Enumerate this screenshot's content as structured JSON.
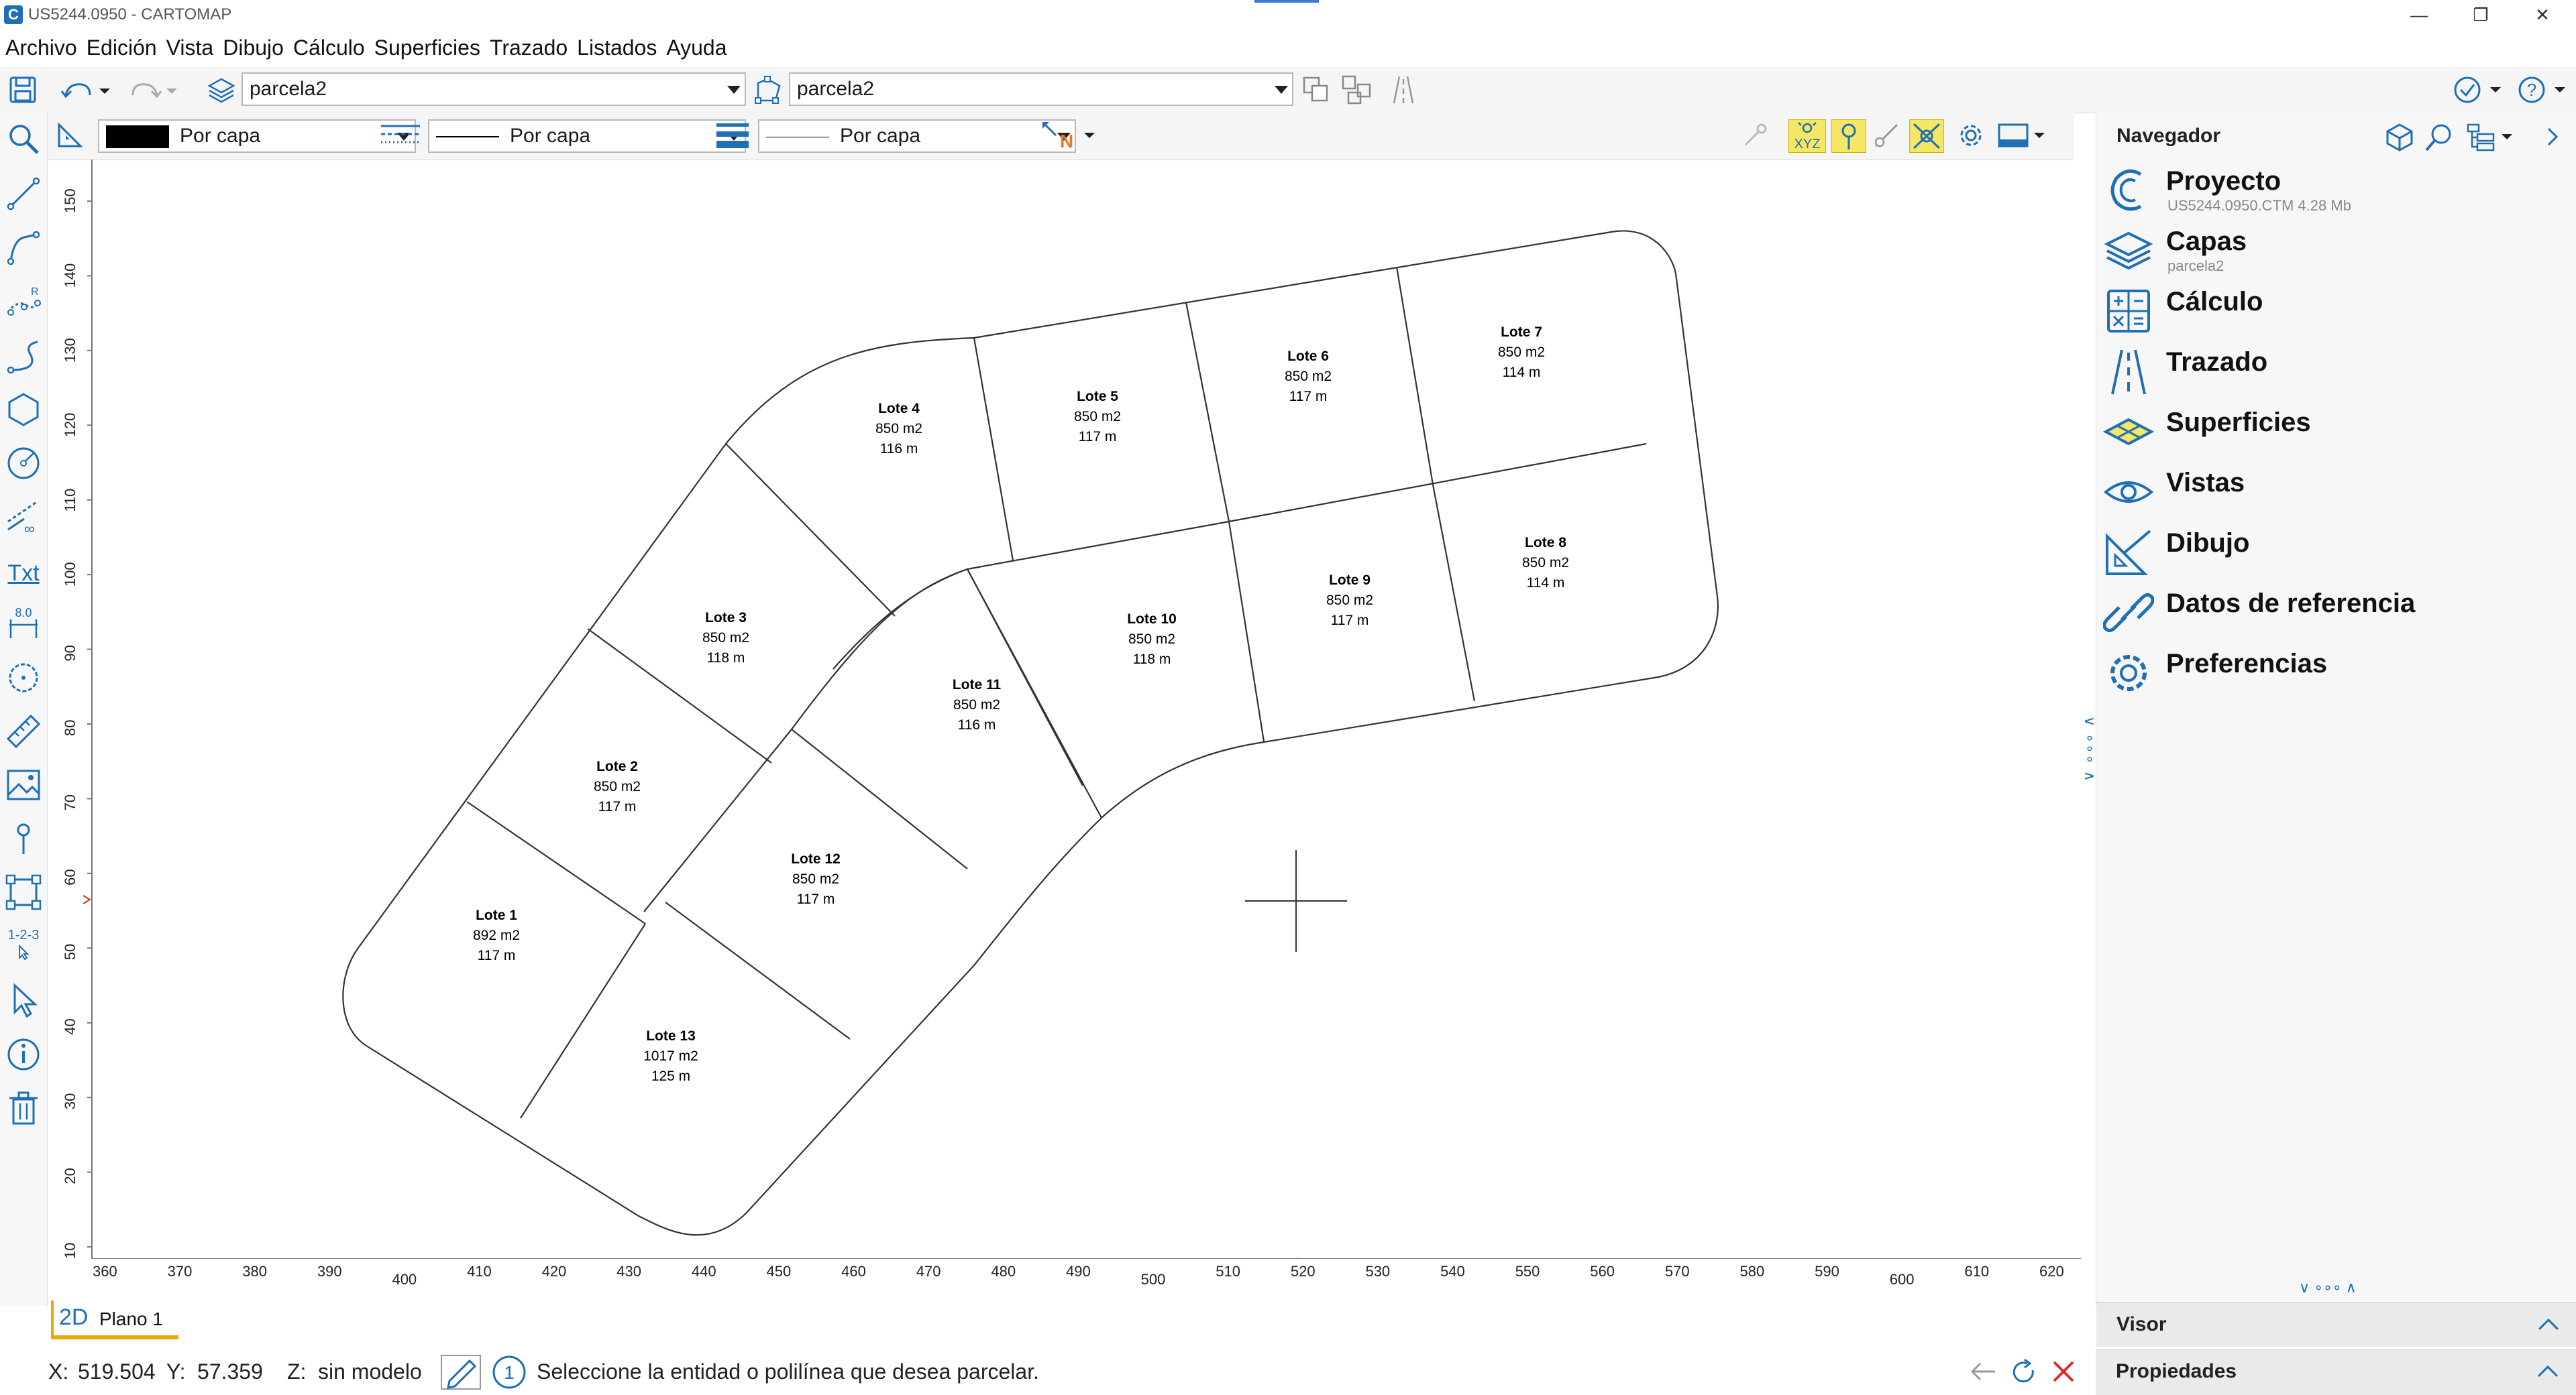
{
  "window": {
    "title": "US5244.0950 - CARTOMAP",
    "logo_letter": "C",
    "minimize": "—",
    "maximize": "❐",
    "close": "✕"
  },
  "menu": [
    "Archivo",
    "Edición",
    "Vista",
    "Dibujo",
    "Cálculo",
    "Superficies",
    "Trazado",
    "Listados",
    "Ayuda"
  ],
  "toolbar": {
    "layer_combo_1": "parcela2",
    "layer_combo_2": "parcela2"
  },
  "toolbar2": {
    "color_combo": "Por capa",
    "linetype_combo": "Por capa",
    "lineweight_combo": "Por capa",
    "north_letter": "N",
    "xyz_label": "XYZ",
    "color_swatch": "#000000"
  },
  "left_tools": {
    "text_tool": "Txt",
    "dimension_tool": "8.0",
    "numbering_tool": "1-2-3",
    "arc_tool": "R"
  },
  "axes": {
    "x_ticks": [
      "360",
      "370",
      "380",
      "390",
      "400",
      "410",
      "420",
      "430",
      "440",
      "450",
      "460",
      "470",
      "480",
      "490",
      "500",
      "510",
      "520",
      "530",
      "540",
      "550",
      "560",
      "570",
      "580",
      "590",
      "600",
      "610",
      "620"
    ],
    "y_ticks": [
      "150",
      "140",
      "130",
      "120",
      "110",
      "100",
      "90",
      "80",
      "70",
      "60",
      "50",
      "40",
      "30",
      "20",
      "10"
    ]
  },
  "lots": [
    {
      "name": "Lote 1",
      "area": "892 m2",
      "perimeter": "117 m"
    },
    {
      "name": "Lote 2",
      "area": "850 m2",
      "perimeter": "117 m"
    },
    {
      "name": "Lote 3",
      "area": "850 m2",
      "perimeter": "118 m"
    },
    {
      "name": "Lote 4",
      "area": "850 m2",
      "perimeter": "116 m"
    },
    {
      "name": "Lote 5",
      "area": "850 m2",
      "perimeter": "117 m"
    },
    {
      "name": "Lote 6",
      "area": "850 m2",
      "perimeter": "117 m"
    },
    {
      "name": "Lote 7",
      "area": "850 m2",
      "perimeter": "114 m"
    },
    {
      "name": "Lote 8",
      "area": "850 m2",
      "perimeter": "114 m"
    },
    {
      "name": "Lote 9",
      "area": "850 m2",
      "perimeter": "117 m"
    },
    {
      "name": "Lote 10",
      "area": "850 m2",
      "perimeter": "118 m"
    },
    {
      "name": "Lote 11",
      "area": "850 m2",
      "perimeter": "116 m"
    },
    {
      "name": "Lote 12",
      "area": "850 m2",
      "perimeter": "117 m"
    },
    {
      "name": "Lote 13",
      "area": "1017 m2",
      "perimeter": "125 m"
    }
  ],
  "navigator": {
    "title": "Navegador",
    "items": [
      {
        "label": "Proyecto",
        "sub": "US5244.0950.CTM 4.28 Mb"
      },
      {
        "label": "Capas",
        "sub": "parcela2"
      },
      {
        "label": "Cálculo",
        "sub": ""
      },
      {
        "label": "Trazado",
        "sub": ""
      },
      {
        "label": "Superficies",
        "sub": ""
      },
      {
        "label": "Vistas",
        "sub": ""
      },
      {
        "label": "Dibujo",
        "sub": ""
      },
      {
        "label": "Datos de referencia",
        "sub": ""
      },
      {
        "label": "Preferencias",
        "sub": ""
      }
    ],
    "splitter_marks": "∨ ∘∘∘ ∧",
    "viewer": "Visor",
    "properties": "Propiedades"
  },
  "tabs": {
    "plan_mode": "2D",
    "plan_label": "Plano 1"
  },
  "status": {
    "x_label": "X:",
    "x_value": "519.504",
    "y_label": "Y:",
    "y_value": "57.359",
    "z_label": "Z:",
    "z_value": "sin modelo",
    "step": "1",
    "prompt": "Seleccione la entidad o polilínea que desea parcelar."
  },
  "colors": {
    "accent": "#1e6fb5",
    "tab_highlight": "#f0a500",
    "cancel": "#d32f2f",
    "snap_active": "#f5e663"
  }
}
